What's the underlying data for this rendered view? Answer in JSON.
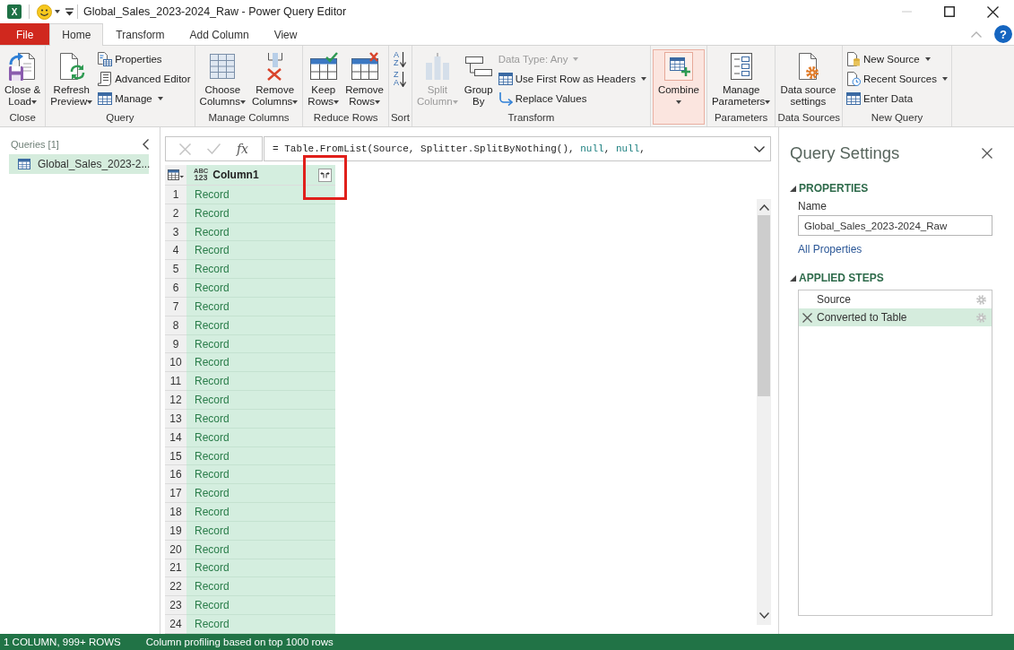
{
  "window": {
    "logo": "X",
    "title": "Global_Sales_2023-2024_Raw - Power Query Editor",
    "minimize_disabled": true
  },
  "ribbon_tabs": [
    {
      "label": "File",
      "kind": "file",
      "selected": false
    },
    {
      "label": "Home",
      "kind": "tab",
      "selected": true
    },
    {
      "label": "Transform",
      "kind": "tab",
      "selected": false
    },
    {
      "label": "Add Column",
      "kind": "tab",
      "selected": false
    },
    {
      "label": "View",
      "kind": "tab",
      "selected": false
    }
  ],
  "help": "?",
  "ribbon": {
    "groups": [
      {
        "label": "Close",
        "items": [
          {
            "kind": "large",
            "lines": [
              "Close &",
              "Load"
            ],
            "dropdown": true,
            "disabled": false,
            "hovered": false
          }
        ]
      },
      {
        "label": "Query",
        "items": [
          {
            "kind": "large",
            "lines": [
              "Refresh",
              "Preview"
            ],
            "dropdown": true,
            "disabled": false,
            "hovered": false
          },
          {
            "kind": "stack",
            "items": [
              {
                "kind": "button",
                "label": "Properties",
                "dropdown": false,
                "disabled": false
              },
              {
                "kind": "button",
                "label": "Advanced Editor",
                "dropdown": false,
                "disabled": false
              },
              {
                "kind": "button",
                "label": "Manage",
                "dropdown": true,
                "disabled": false
              }
            ]
          }
        ]
      },
      {
        "label": "Manage Columns",
        "items": [
          {
            "kind": "large",
            "lines": [
              "Choose",
              "Columns"
            ],
            "dropdown": true,
            "disabled": false,
            "hovered": false
          },
          {
            "kind": "large",
            "lines": [
              "Remove",
              "Columns"
            ],
            "dropdown": true,
            "disabled": false,
            "hovered": false
          }
        ]
      },
      {
        "label": "Reduce Rows",
        "items": [
          {
            "kind": "large",
            "lines": [
              "Keep",
              "Rows"
            ],
            "dropdown": true,
            "disabled": false,
            "hovered": false
          },
          {
            "kind": "large",
            "lines": [
              "Remove",
              "Rows"
            ],
            "dropdown": true,
            "disabled": false,
            "hovered": false
          }
        ]
      },
      {
        "label": "Sort",
        "items": [
          {
            "kind": "stack",
            "items": [
              {
                "kind": "sort",
                "letters": [
                  "A",
                  "Z"
                ]
              },
              {
                "kind": "sort",
                "letters": [
                  "Z",
                  "A"
                ]
              }
            ]
          }
        ]
      },
      {
        "label": "Transform",
        "items": [
          {
            "kind": "large",
            "lines": [
              "Split",
              "Column"
            ],
            "dropdown": true,
            "disabled": true,
            "hovered": false
          },
          {
            "kind": "large",
            "lines": [
              "Group",
              "By"
            ],
            "dropdown": false,
            "disabled": false,
            "hovered": false
          },
          {
            "kind": "stack",
            "items": [
              {
                "kind": "select",
                "label": "Data Type: Any",
                "dropdown": true,
                "disabled": true
              },
              {
                "kind": "button",
                "label": "Use First Row as Headers",
                "dropdown": true,
                "disabled": false
              },
              {
                "kind": "button",
                "label": "Replace Values",
                "dropdown": false,
                "disabled": false
              }
            ]
          }
        ]
      },
      {
        "items": [
          {
            "kind": "large",
            "lines": [
              "Combine"
            ],
            "dropdown": true,
            "disabled": false,
            "hovered": true
          }
        ]
      },
      {
        "label": "Parameters",
        "items": [
          {
            "kind": "large",
            "lines": [
              "Manage",
              "Parameters"
            ],
            "dropdown": true,
            "disabled": false,
            "hovered": false
          }
        ]
      },
      {
        "label": "Data Sources",
        "items": [
          {
            "kind": "large",
            "lines": [
              "Data source",
              "settings"
            ],
            "dropdown": false,
            "disabled": false,
            "hovered": false
          }
        ]
      },
      {
        "label": "New Query",
        "items": [
          {
            "kind": "stack",
            "items": [
              {
                "kind": "button",
                "label": "New Source",
                "dropdown": true,
                "disabled": false
              },
              {
                "kind": "button",
                "label": "Recent Sources",
                "dropdown": true,
                "disabled": false
              },
              {
                "kind": "button",
                "label": "Enter Data",
                "dropdown": false,
                "disabled": false
              }
            ]
          }
        ]
      }
    ]
  },
  "queries": {
    "heading": "Queries [1]",
    "items": [
      {
        "label": "Global_Sales_2023-2...",
        "selected": true
      }
    ]
  },
  "formula_bar": {
    "edit_buttons_disabled": true,
    "fx": "fx",
    "tokens": [
      {
        "kind": "plain",
        "text": "= Table.FromList(Source, Splitter.SplitByNothing(), "
      },
      {
        "kind": "keyword",
        "text": "null"
      },
      {
        "kind": "plain",
        "text": ", "
      },
      {
        "kind": "keyword",
        "text": "null"
      },
      {
        "kind": "plain",
        "text": ","
      }
    ]
  },
  "table": {
    "columns": [
      {
        "name": "Column1",
        "type": [
          "ABC",
          "123"
        ],
        "selected": true,
        "annotated": true
      }
    ],
    "rows": [
      {
        "number": "1",
        "cells": [
          "Record"
        ]
      },
      {
        "number": "2",
        "cells": [
          "Record"
        ]
      },
      {
        "number": "3",
        "cells": [
          "Record"
        ]
      },
      {
        "number": "4",
        "cells": [
          "Record"
        ]
      },
      {
        "number": "5",
        "cells": [
          "Record"
        ]
      },
      {
        "number": "6",
        "cells": [
          "Record"
        ]
      },
      {
        "number": "7",
        "cells": [
          "Record"
        ]
      },
      {
        "number": "8",
        "cells": [
          "Record"
        ]
      },
      {
        "number": "9",
        "cells": [
          "Record"
        ]
      },
      {
        "number": "10",
        "cells": [
          "Record"
        ]
      },
      {
        "number": "11",
        "cells": [
          "Record"
        ]
      },
      {
        "number": "12",
        "cells": [
          "Record"
        ]
      },
      {
        "number": "13",
        "cells": [
          "Record"
        ]
      },
      {
        "number": "14",
        "cells": [
          "Record"
        ]
      },
      {
        "number": "15",
        "cells": [
          "Record"
        ]
      },
      {
        "number": "16",
        "cells": [
          "Record"
        ]
      },
      {
        "number": "17",
        "cells": [
          "Record"
        ]
      },
      {
        "number": "18",
        "cells": [
          "Record"
        ]
      },
      {
        "number": "19",
        "cells": [
          "Record"
        ]
      },
      {
        "number": "20",
        "cells": [
          "Record"
        ]
      },
      {
        "number": "21",
        "cells": [
          "Record"
        ]
      },
      {
        "number": "22",
        "cells": [
          "Record"
        ]
      },
      {
        "number": "23",
        "cells": [
          "Record"
        ]
      },
      {
        "number": "24",
        "cells": [
          "Record"
        ]
      }
    ]
  },
  "query_settings": {
    "title": "Query Settings",
    "properties": {
      "heading": "PROPERTIES",
      "expanded": true,
      "name_label": "Name",
      "name_value": "Global_Sales_2023-2024_Raw",
      "link": "All Properties"
    },
    "applied_steps": {
      "heading": "APPLIED STEPS",
      "expanded": true,
      "steps": [
        {
          "label": "Source",
          "selected": false
        },
        {
          "label": "Converted to Table",
          "selected": true
        }
      ]
    }
  },
  "status_bar": [
    "1 COLUMN, 999+ ROWS",
    "Column profiling based on top 1000 rows"
  ]
}
